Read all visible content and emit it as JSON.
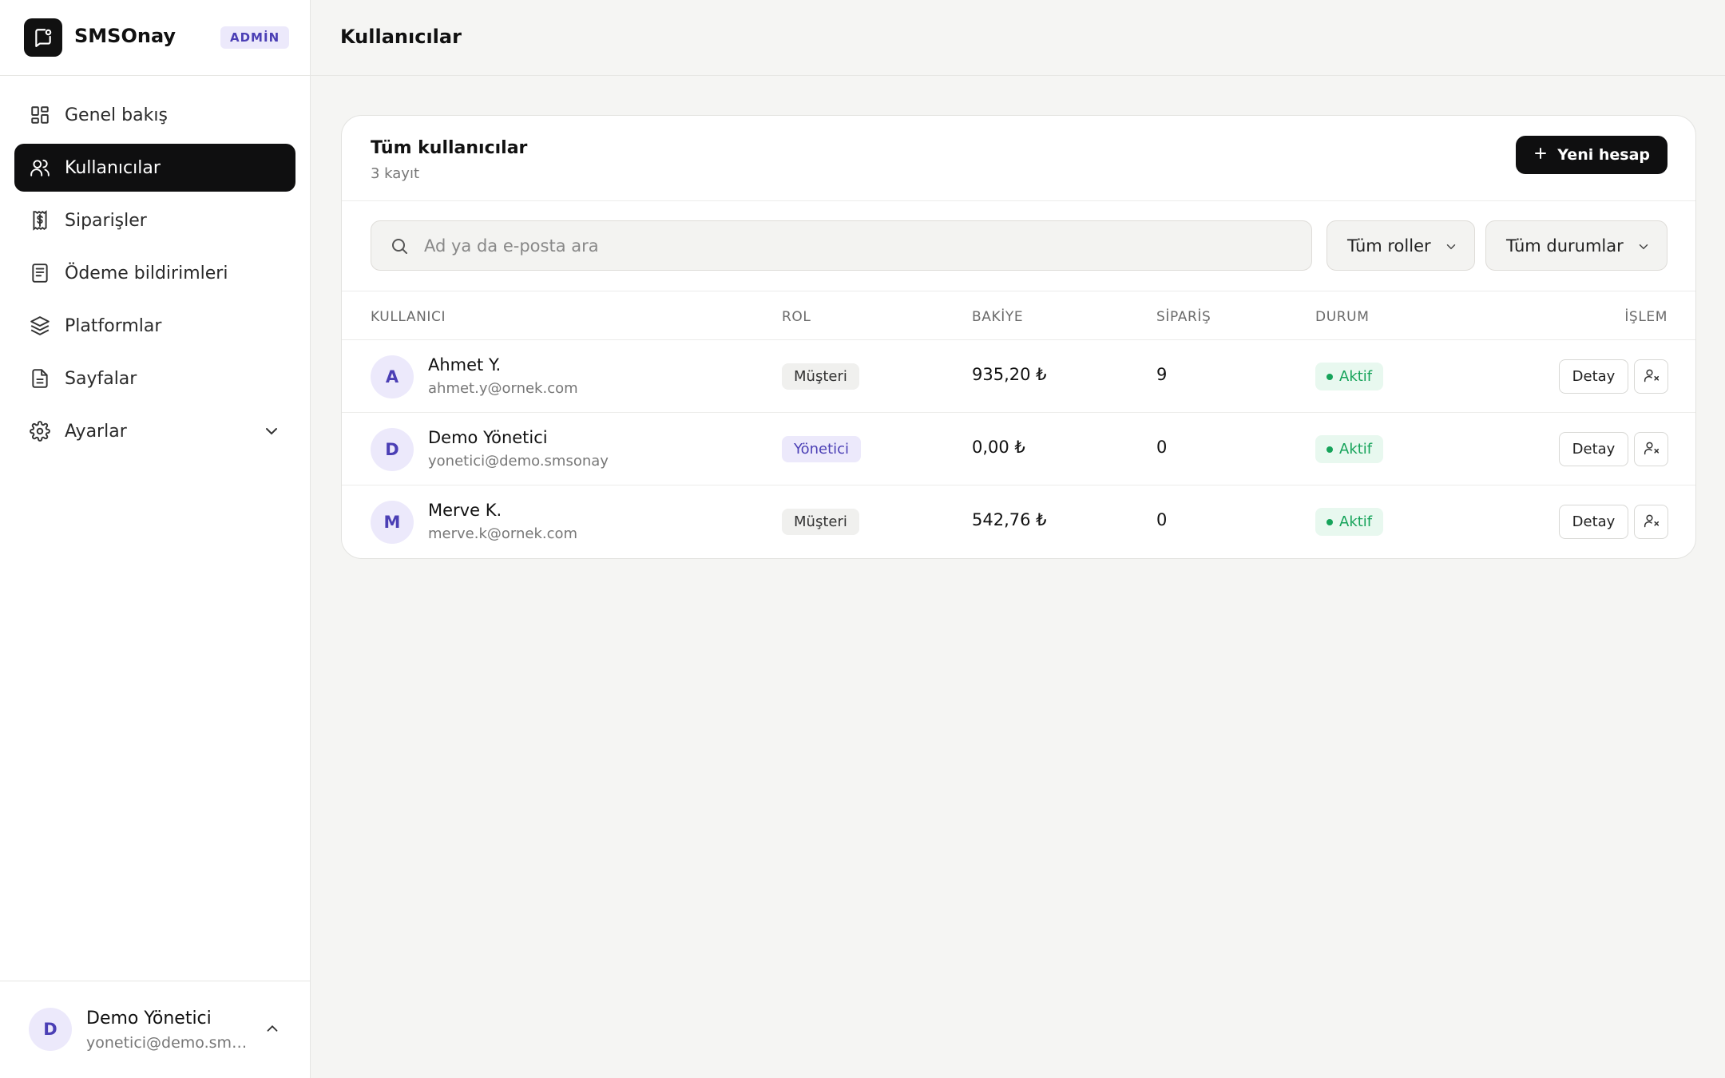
{
  "brand": {
    "name": "SMSOnay",
    "badge": "ADMİN"
  },
  "sidebar": {
    "items": [
      {
        "label": "Genel bakış",
        "icon": "grid-icon"
      },
      {
        "label": "Kullanıcılar",
        "icon": "users-icon",
        "active": true
      },
      {
        "label": "Siparişler",
        "icon": "receipt-icon"
      },
      {
        "label": "Ödeme bildirimleri",
        "icon": "document-list-icon"
      },
      {
        "label": "Platformlar",
        "icon": "layers-icon"
      },
      {
        "label": "Sayfalar",
        "icon": "file-icon"
      },
      {
        "label": "Ayarlar",
        "icon": "gear-icon",
        "expandable": true
      }
    ],
    "user": {
      "initial": "D",
      "name": "Demo Yönetici",
      "email": "yonetici@demo.sms..."
    }
  },
  "header": {
    "title": "Kullanıcılar"
  },
  "card": {
    "title": "Tüm kullanıcılar",
    "subtitle": "3 kayıt",
    "new_button": "Yeni hesap"
  },
  "filters": {
    "search_placeholder": "Ad ya da e-posta ara",
    "role_select": "Tüm roller",
    "status_select": "Tüm durumlar"
  },
  "table": {
    "columns": [
      "KULLANICI",
      "ROL",
      "BAKİYE",
      "SİPARİŞ",
      "DURUM",
      "İŞLEM"
    ],
    "rows": [
      {
        "initial": "A",
        "name": "Ahmet Y.",
        "email": "ahmet.y@ornek.com",
        "role": "Müşteri",
        "balance": "935,20 ₺",
        "orders": "9",
        "status": "Aktif",
        "action": "Detay"
      },
      {
        "initial": "D",
        "name": "Demo Yönetici",
        "email": "yonetici@demo.smsonay",
        "role": "Yönetici",
        "balance": "0,00 ₺",
        "orders": "0",
        "status": "Aktif",
        "action": "Detay"
      },
      {
        "initial": "M",
        "name": "Merve K.",
        "email": "merve.k@ornek.com",
        "role": "Müşteri",
        "balance": "542,76 ₺",
        "orders": "0",
        "status": "Aktif",
        "action": "Detay"
      }
    ]
  },
  "colors": {
    "accent": "#0f0f10",
    "avatar_bg": "#ece9fb",
    "avatar_fg": "#4b3fb5",
    "status_active": "#16a35a"
  }
}
